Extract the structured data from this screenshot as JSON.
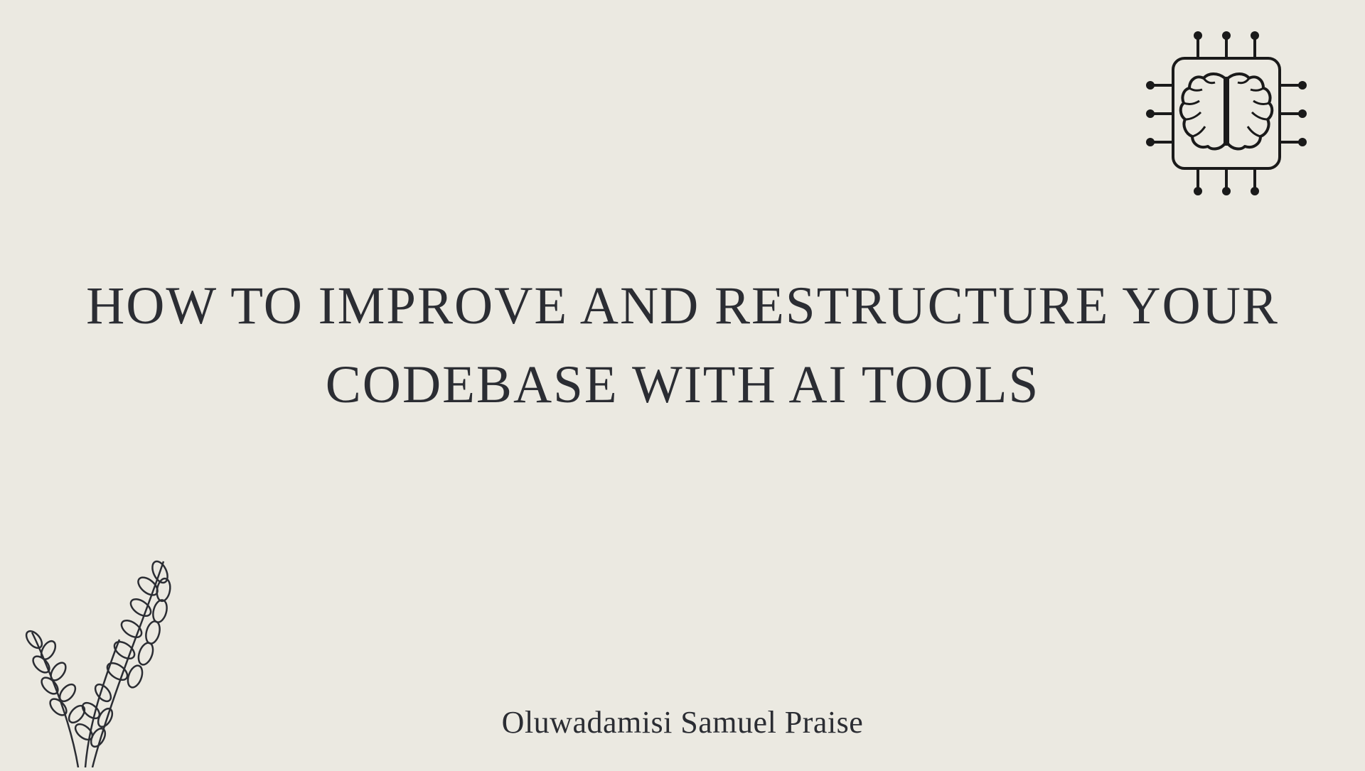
{
  "title": "HOW TO IMPROVE AND RESTRUCTURE YOUR CODEBASE WITH AI TOOLS",
  "author": "Oluwadamisi Samuel Praise",
  "icons": {
    "top_right": "brain-chip-icon",
    "bottom_left": "plant-branch-decoration"
  },
  "colors": {
    "background": "#ebe9e1",
    "text": "#2b2d33",
    "icon_stroke": "#1a1a1a"
  }
}
